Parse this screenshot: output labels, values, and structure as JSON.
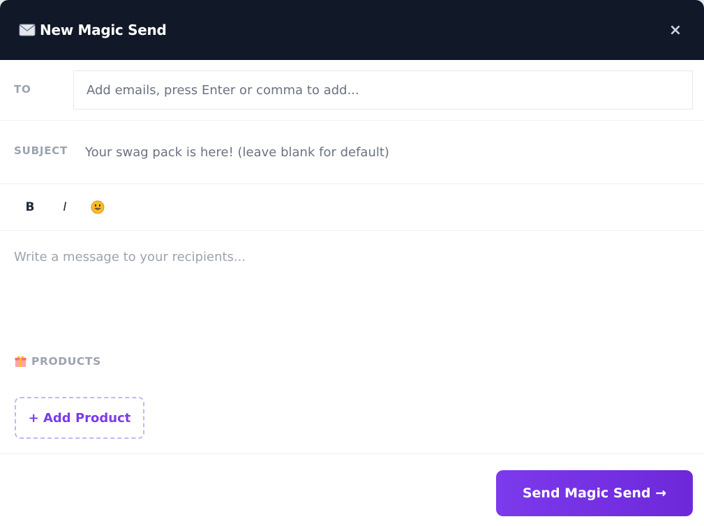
{
  "header": {
    "title": "New Magic Send",
    "title_icon": "envelope-icon",
    "close_label": "×",
    "close_icon": "close-icon"
  },
  "to": {
    "label": "TO",
    "placeholder": "Add emails, press Enter or comma to add...",
    "value": ""
  },
  "subject": {
    "label": "SUBJECT",
    "placeholder": "Your swag pack is here! (leave blank for default)",
    "value": ""
  },
  "toolbar": {
    "bold_label": "B",
    "italic_label": "I",
    "emoji_icon": "smiley-icon"
  },
  "message": {
    "placeholder": "Write a message to your recipients...",
    "value": ""
  },
  "products": {
    "label": "PRODUCTS",
    "icon": "gift-icon",
    "add_label": "+ Add Product"
  },
  "footer": {
    "send_label": "Send Magic Send →"
  },
  "colors": {
    "header_bg": "#111827",
    "accent": "#7c3aed",
    "dashed_border": "#c4b5fd",
    "label_gray": "#9ca3af"
  }
}
